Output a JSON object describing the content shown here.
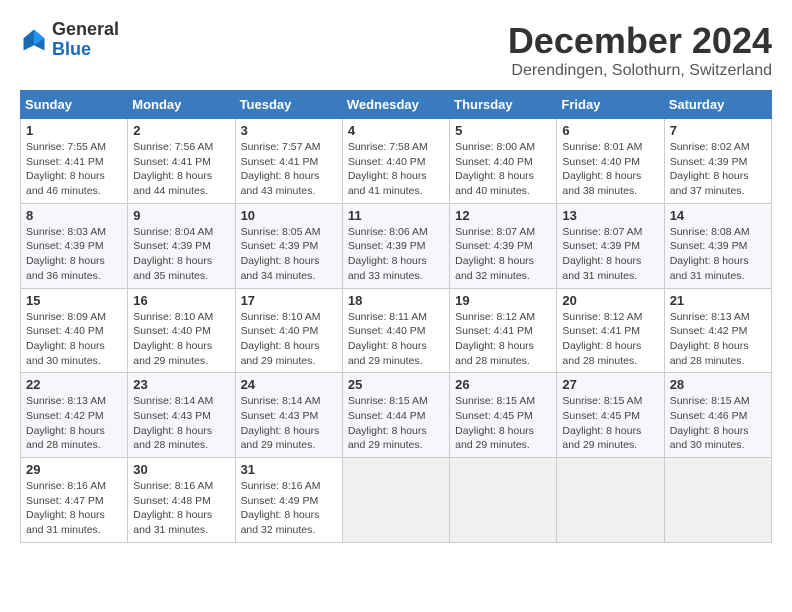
{
  "header": {
    "logo_general": "General",
    "logo_blue": "Blue",
    "month_title": "December 2024",
    "location": "Derendingen, Solothurn, Switzerland"
  },
  "weekdays": [
    "Sunday",
    "Monday",
    "Tuesday",
    "Wednesday",
    "Thursday",
    "Friday",
    "Saturday"
  ],
  "weeks": [
    [
      {
        "day": "1",
        "sunrise": "7:55 AM",
        "sunset": "4:41 PM",
        "daylight": "8 hours and 46 minutes."
      },
      {
        "day": "2",
        "sunrise": "7:56 AM",
        "sunset": "4:41 PM",
        "daylight": "8 hours and 44 minutes."
      },
      {
        "day": "3",
        "sunrise": "7:57 AM",
        "sunset": "4:41 PM",
        "daylight": "8 hours and 43 minutes."
      },
      {
        "day": "4",
        "sunrise": "7:58 AM",
        "sunset": "4:40 PM",
        "daylight": "8 hours and 41 minutes."
      },
      {
        "day": "5",
        "sunrise": "8:00 AM",
        "sunset": "4:40 PM",
        "daylight": "8 hours and 40 minutes."
      },
      {
        "day": "6",
        "sunrise": "8:01 AM",
        "sunset": "4:40 PM",
        "daylight": "8 hours and 38 minutes."
      },
      {
        "day": "7",
        "sunrise": "8:02 AM",
        "sunset": "4:39 PM",
        "daylight": "8 hours and 37 minutes."
      }
    ],
    [
      {
        "day": "8",
        "sunrise": "8:03 AM",
        "sunset": "4:39 PM",
        "daylight": "8 hours and 36 minutes."
      },
      {
        "day": "9",
        "sunrise": "8:04 AM",
        "sunset": "4:39 PM",
        "daylight": "8 hours and 35 minutes."
      },
      {
        "day": "10",
        "sunrise": "8:05 AM",
        "sunset": "4:39 PM",
        "daylight": "8 hours and 34 minutes."
      },
      {
        "day": "11",
        "sunrise": "8:06 AM",
        "sunset": "4:39 PM",
        "daylight": "8 hours and 33 minutes."
      },
      {
        "day": "12",
        "sunrise": "8:07 AM",
        "sunset": "4:39 PM",
        "daylight": "8 hours and 32 minutes."
      },
      {
        "day": "13",
        "sunrise": "8:07 AM",
        "sunset": "4:39 PM",
        "daylight": "8 hours and 31 minutes."
      },
      {
        "day": "14",
        "sunrise": "8:08 AM",
        "sunset": "4:39 PM",
        "daylight": "8 hours and 31 minutes."
      }
    ],
    [
      {
        "day": "15",
        "sunrise": "8:09 AM",
        "sunset": "4:40 PM",
        "daylight": "8 hours and 30 minutes."
      },
      {
        "day": "16",
        "sunrise": "8:10 AM",
        "sunset": "4:40 PM",
        "daylight": "8 hours and 29 minutes."
      },
      {
        "day": "17",
        "sunrise": "8:10 AM",
        "sunset": "4:40 PM",
        "daylight": "8 hours and 29 minutes."
      },
      {
        "day": "18",
        "sunrise": "8:11 AM",
        "sunset": "4:40 PM",
        "daylight": "8 hours and 29 minutes."
      },
      {
        "day": "19",
        "sunrise": "8:12 AM",
        "sunset": "4:41 PM",
        "daylight": "8 hours and 28 minutes."
      },
      {
        "day": "20",
        "sunrise": "8:12 AM",
        "sunset": "4:41 PM",
        "daylight": "8 hours and 28 minutes."
      },
      {
        "day": "21",
        "sunrise": "8:13 AM",
        "sunset": "4:42 PM",
        "daylight": "8 hours and 28 minutes."
      }
    ],
    [
      {
        "day": "22",
        "sunrise": "8:13 AM",
        "sunset": "4:42 PM",
        "daylight": "8 hours and 28 minutes."
      },
      {
        "day": "23",
        "sunrise": "8:14 AM",
        "sunset": "4:43 PM",
        "daylight": "8 hours and 28 minutes."
      },
      {
        "day": "24",
        "sunrise": "8:14 AM",
        "sunset": "4:43 PM",
        "daylight": "8 hours and 29 minutes."
      },
      {
        "day": "25",
        "sunrise": "8:15 AM",
        "sunset": "4:44 PM",
        "daylight": "8 hours and 29 minutes."
      },
      {
        "day": "26",
        "sunrise": "8:15 AM",
        "sunset": "4:45 PM",
        "daylight": "8 hours and 29 minutes."
      },
      {
        "day": "27",
        "sunrise": "8:15 AM",
        "sunset": "4:45 PM",
        "daylight": "8 hours and 29 minutes."
      },
      {
        "day": "28",
        "sunrise": "8:15 AM",
        "sunset": "4:46 PM",
        "daylight": "8 hours and 30 minutes."
      }
    ],
    [
      {
        "day": "29",
        "sunrise": "8:16 AM",
        "sunset": "4:47 PM",
        "daylight": "8 hours and 31 minutes."
      },
      {
        "day": "30",
        "sunrise": "8:16 AM",
        "sunset": "4:48 PM",
        "daylight": "8 hours and 31 minutes."
      },
      {
        "day": "31",
        "sunrise": "8:16 AM",
        "sunset": "4:49 PM",
        "daylight": "8 hours and 32 minutes."
      },
      null,
      null,
      null,
      null
    ]
  ],
  "labels": {
    "sunrise_prefix": "Sunrise: ",
    "sunset_prefix": "Sunset: ",
    "daylight_prefix": "Daylight: "
  }
}
